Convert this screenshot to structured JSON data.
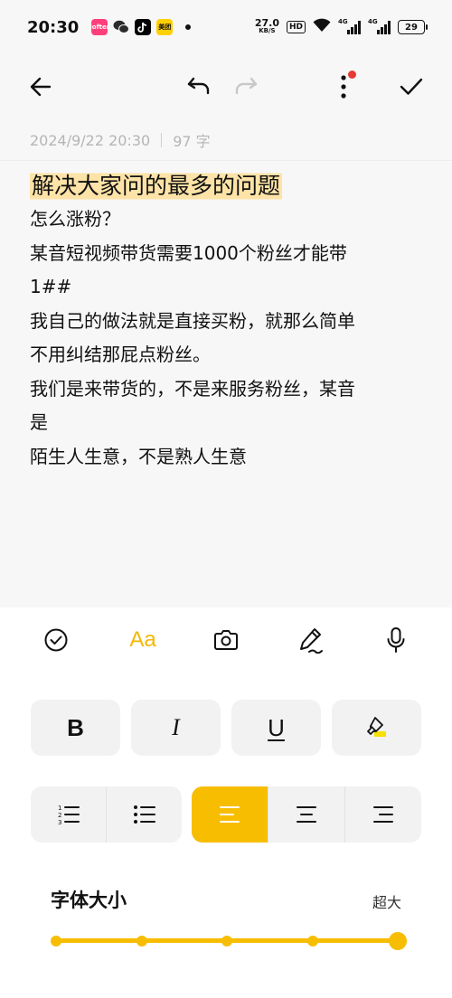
{
  "status_bar": {
    "time": "20:30",
    "apps": [
      {
        "name": "lofter-app-icon",
        "color": "#ff3f7a",
        "label": "lofter"
      },
      {
        "name": "wechat-app-icon",
        "color": "#2b2b2b",
        "label": ""
      },
      {
        "name": "douyin-app-icon",
        "color": "#000000",
        "label": ""
      },
      {
        "name": "meituan-app-icon",
        "color": "#ffd000",
        "label": "美团"
      }
    ],
    "net_speed_value": "27.0",
    "net_speed_unit": "KB/S",
    "hd": "HD",
    "signal1_label": "4G",
    "signal2_label": "4G",
    "battery": "29"
  },
  "toolbar": {
    "back_icon": "arrow-left-icon",
    "undo_icon": "undo-icon",
    "redo_icon": "redo-icon",
    "more_icon": "more-vertical-icon",
    "done_icon": "check-icon",
    "notification_dot_color": "#e53935"
  },
  "note_meta": {
    "datetime": "2024/9/22 20:30",
    "word_count": "97 字"
  },
  "note": {
    "title": "解决大家问的最多的问题",
    "title_highlight_color": "#fde3a7",
    "lines": [
      "怎么涨粉？",
      "某音短视频带货需要1000个粉丝才能带",
      "1##",
      "我自己的做法就是直接买粉，就那么简单",
      "不用纠结那屁点粉丝。",
      "我们是来带货的，不是来服务粉丝，某音",
      "是",
      "陌生人生意，不是熟人生意"
    ]
  },
  "panel": {
    "tools": {
      "checklist_icon": "check-circle-icon",
      "text_format_label": "Aa",
      "camera_icon": "camera-icon",
      "handwriting_icon": "pen-icon",
      "voice_icon": "microphone-icon"
    },
    "format_buttons": {
      "bold": "B",
      "italic": "I",
      "underline": "U",
      "highlight_icon": "highlighter-icon"
    },
    "list_buttons": [
      "numbered-list-icon",
      "bullet-list-icon"
    ],
    "align_buttons": [
      "align-left-icon",
      "align-center-icon",
      "align-right-icon"
    ],
    "active_align": "left",
    "accent_color": "#f7bd00",
    "font_size": {
      "label": "字体大小",
      "value": "超大",
      "steps": 5,
      "selected_step": 5
    }
  }
}
